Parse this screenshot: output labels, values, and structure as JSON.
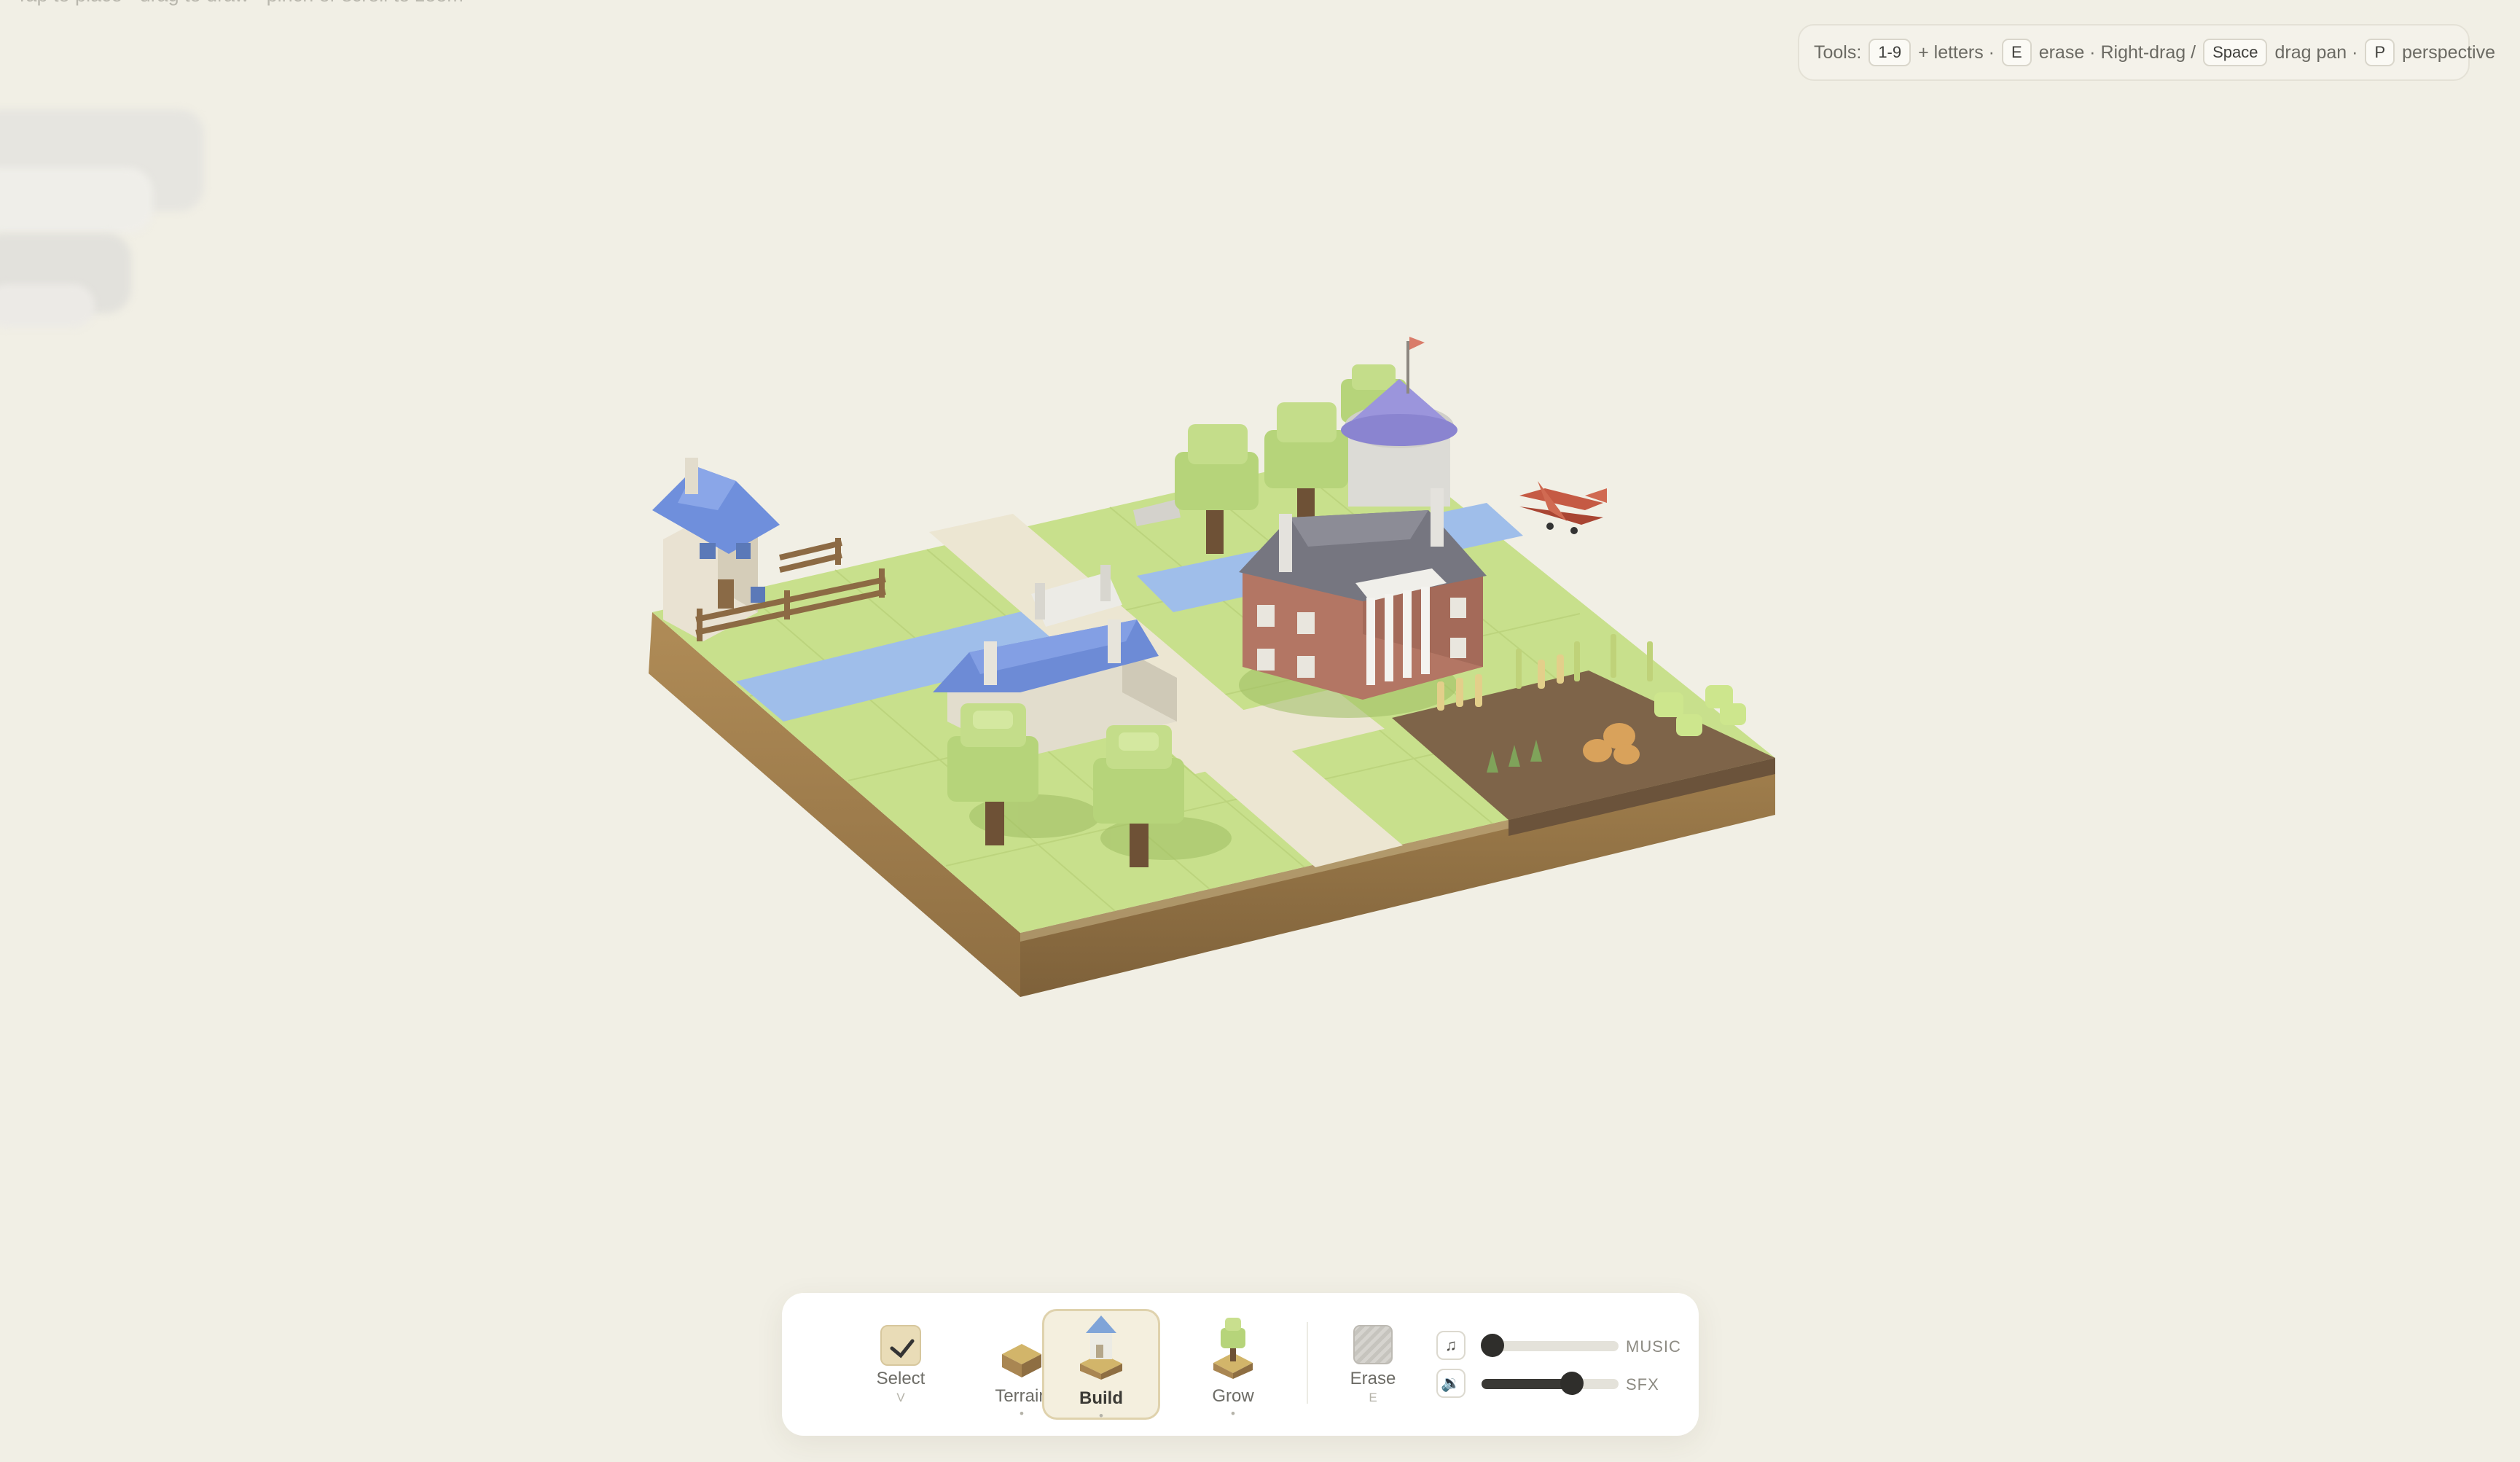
{
  "hint": {
    "text": "Tap to place · drag to draw · pinch or scroll to zoom"
  },
  "shortcuts": {
    "prefix": "Tools:",
    "tools_key": "1-9",
    "letters": "+ letters ·",
    "erase_key": "E",
    "erase_text": "erase · Right-drag /",
    "pan_key": "Space",
    "pan_text": "drag pan ·",
    "persp_key": "P",
    "persp_text": "perspective"
  },
  "toolbar": {
    "active_tool": "build",
    "tools": [
      {
        "id": "select",
        "label": "Select",
        "key": "V",
        "icon": "pointer-cursor-icon"
      },
      {
        "id": "terrain",
        "label": "Terrain",
        "key": "•",
        "icon": "terrain-block-icon"
      },
      {
        "id": "build",
        "label": "Build",
        "key": "•",
        "icon": "house-block-icon"
      },
      {
        "id": "grow",
        "label": "Grow",
        "key": "•",
        "icon": "tree-block-icon"
      },
      {
        "id": "erase",
        "label": "Erase",
        "key": "E",
        "icon": "erase-tile-icon"
      }
    ],
    "music": {
      "label": "MUSIC",
      "icon": "music-note-icon",
      "level": 0.08
    },
    "sfx": {
      "label": "SFX",
      "icon": "speaker-icon",
      "level": 0.66
    }
  },
  "colors": {
    "background": "#f1efe5",
    "grass": "#c7e08a",
    "water": "#9dbde8",
    "path": "#ece6d2",
    "soil": "#8a6a46",
    "earth_side": "#a98652",
    "accent_active": "#dfd2ad"
  },
  "scene": {
    "objects": [
      "cottage-blue-roof",
      "wooden-fence",
      "river",
      "bridge-gate",
      "farmhouse-blue-roof",
      "trees",
      "mansion-with-columns",
      "silo-purple-roof",
      "flag",
      "biplane",
      "wheat-crops",
      "pumpkins",
      "bushes"
    ]
  }
}
